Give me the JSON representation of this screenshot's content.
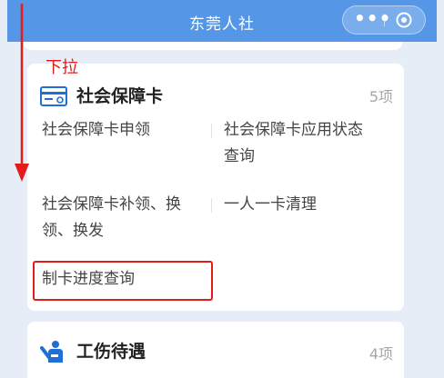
{
  "app": {
    "title": "东莞人社",
    "capsule_more_label": "•••"
  },
  "colors": {
    "navbar": "#5596e6",
    "background": "#e7edf7",
    "card": "#ffffff",
    "icon_blue": "#1f6fd6",
    "annotation_red": "#e21b1b"
  },
  "icons": {
    "more": "more-dots-icon",
    "close": "target-circle-icon",
    "social_card": "card-icon",
    "injury": "injury-person-icon",
    "arrow": "down-arrow-icon"
  },
  "sections": [
    {
      "title": "社会保障卡",
      "count": "5项",
      "items": [
        {
          "label": "社会保障卡申领"
        },
        {
          "label_line1": "社会保障卡应用状态",
          "label_line2": "查询"
        },
        {
          "label_line1": "社会保障卡补领、换",
          "label_line2": "领、换发"
        },
        {
          "label": "一人一卡清理"
        },
        {
          "label": "制卡进度查询",
          "highlighted": true
        }
      ]
    },
    {
      "title": "工伤待遇",
      "count": "4项"
    }
  ],
  "annotation": {
    "label": "下拉"
  }
}
